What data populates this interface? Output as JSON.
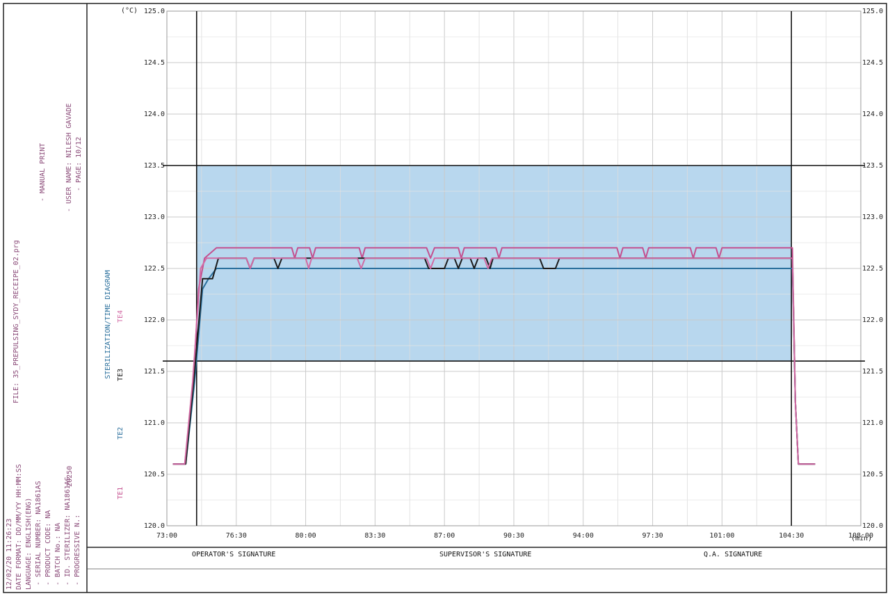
{
  "header": {
    "file": "FILE: 35_PREPULSING_SYDY_RECEIPE_02.prg",
    "manual_print": "- MANUAL PRINT",
    "user_name": "- USER NAME: NILESH GAVADE",
    "page": "- PAGE: 10/12",
    "datetime": "12/02/20 11:26:23",
    "date_format": "DATE FORMAT: DD/MM/YY HH:MM:SS",
    "language": "LANGUAGE: ENGLISH(ENG)",
    "serial_number": "- SERIAL NUMBER: NA1861AS",
    "product_code": "- PRODUCT CODE: NA",
    "batch_no": "- BATCH No.: NA",
    "id_sterilizer": "- ID. STERILIZER: NA1861AS",
    "progressive_n": "- PROGRESSIVE N.:",
    "progressive_val": "20250"
  },
  "colors": {
    "band": "#b8d7ee",
    "te1": "#c4508f",
    "te2": "#2a6f9c",
    "te3": "#1a1a1a",
    "te4": "#d26aa4",
    "grid": "#c9c9c9"
  },
  "signatures": {
    "operator": "OPERATOR'S SIGNATURE",
    "supervisor": "SUPERVISOR'S SIGNATURE",
    "qa": "Q.A. SIGNATURE"
  },
  "chart_data": {
    "type": "line",
    "title": "STERILIZATION/TIME DIAGRAM",
    "ylabel": "(°C)",
    "xlabel": "(min)",
    "xlim": [
      73,
      108
    ],
    "ylim": [
      120.0,
      125.0
    ],
    "x_ticks": [
      73,
      76.5,
      80,
      83.5,
      87,
      90.5,
      94,
      97.5,
      101,
      104.5,
      108
    ],
    "x_tick_labels": [
      "73:00",
      "76:30",
      "80:00",
      "83:30",
      "87:00",
      "90:30",
      "94:00",
      "97:30",
      "101:00",
      "104:30",
      "108:00"
    ],
    "y_ticks": [
      120.0,
      120.5,
      121.0,
      121.5,
      122.0,
      122.5,
      123.0,
      123.5,
      124.0,
      124.5,
      125.0
    ],
    "y_tick_labels": [
      "120.0",
      "120.5",
      "121.0",
      "121.5",
      "122.0",
      "122.5",
      "123.0",
      "123.5",
      "124.0",
      "124.5",
      "125.0"
    ],
    "band": [
      121.6,
      123.5
    ],
    "band_x": [
      74.5,
      104.5
    ],
    "vlines": [
      74.5,
      104.5
    ],
    "grid": true,
    "series": [
      {
        "name": "TE1",
        "color": "#c4508f",
        "points": [
          [
            73.3,
            120.6
          ],
          [
            73.9,
            120.6
          ],
          [
            74.3,
            121.3
          ],
          [
            74.6,
            122.3
          ],
          [
            74.9,
            122.6
          ],
          [
            75.5,
            122.7
          ],
          [
            79.3,
            122.7
          ],
          [
            79.45,
            122.6
          ],
          [
            79.6,
            122.7
          ],
          [
            80.2,
            122.7
          ],
          [
            80.35,
            122.6
          ],
          [
            80.5,
            122.7
          ],
          [
            82.7,
            122.7
          ],
          [
            82.85,
            122.6
          ],
          [
            83.0,
            122.7
          ],
          [
            86.1,
            122.7
          ],
          [
            86.3,
            122.6
          ],
          [
            86.5,
            122.7
          ],
          [
            87.7,
            122.7
          ],
          [
            87.85,
            122.6
          ],
          [
            88.0,
            122.7
          ],
          [
            89.6,
            122.7
          ],
          [
            89.75,
            122.6
          ],
          [
            89.9,
            122.7
          ],
          [
            95.7,
            122.7
          ],
          [
            95.85,
            122.6
          ],
          [
            96.0,
            122.7
          ],
          [
            97.0,
            122.7
          ],
          [
            97.15,
            122.6
          ],
          [
            97.3,
            122.7
          ],
          [
            99.4,
            122.7
          ],
          [
            99.55,
            122.6
          ],
          [
            99.7,
            122.7
          ],
          [
            100.7,
            122.7
          ],
          [
            100.85,
            122.6
          ],
          [
            101.0,
            122.7
          ],
          [
            104.55,
            122.7
          ],
          [
            104.7,
            121.2
          ],
          [
            104.85,
            120.6
          ],
          [
            105.7,
            120.6
          ]
        ]
      },
      {
        "name": "TE2",
        "color": "#2a6f9c",
        "points": [
          [
            73.3,
            120.6
          ],
          [
            73.95,
            120.6
          ],
          [
            74.4,
            121.4
          ],
          [
            74.8,
            122.3
          ],
          [
            75.1,
            122.4
          ],
          [
            75.5,
            122.5
          ],
          [
            104.55,
            122.5
          ],
          [
            104.7,
            121.2
          ],
          [
            104.85,
            120.6
          ],
          [
            105.7,
            120.6
          ]
        ]
      },
      {
        "name": "TE3",
        "color": "#1a1a1a",
        "points": [
          [
            73.3,
            120.6
          ],
          [
            73.95,
            120.6
          ],
          [
            74.4,
            121.5
          ],
          [
            74.8,
            122.4
          ],
          [
            75.3,
            122.4
          ],
          [
            75.6,
            122.6
          ],
          [
            77.0,
            122.6
          ],
          [
            77.2,
            122.5
          ],
          [
            77.4,
            122.6
          ],
          [
            78.4,
            122.6
          ],
          [
            78.6,
            122.5
          ],
          [
            78.8,
            122.6
          ],
          [
            86.0,
            122.6
          ],
          [
            86.2,
            122.5
          ],
          [
            87.0,
            122.5
          ],
          [
            87.2,
            122.6
          ],
          [
            87.5,
            122.6
          ],
          [
            87.7,
            122.5
          ],
          [
            87.9,
            122.6
          ],
          [
            88.3,
            122.6
          ],
          [
            88.5,
            122.5
          ],
          [
            88.7,
            122.6
          ],
          [
            89.1,
            122.6
          ],
          [
            89.3,
            122.5
          ],
          [
            89.45,
            122.6
          ],
          [
            91.8,
            122.6
          ],
          [
            92.0,
            122.5
          ],
          [
            92.6,
            122.5
          ],
          [
            92.8,
            122.6
          ],
          [
            104.55,
            122.6
          ],
          [
            104.7,
            121.2
          ],
          [
            104.85,
            120.6
          ],
          [
            105.7,
            120.6
          ]
        ]
      },
      {
        "name": "TE4",
        "color": "#d26aa4",
        "points": [
          [
            73.3,
            120.6
          ],
          [
            73.9,
            120.6
          ],
          [
            74.3,
            121.4
          ],
          [
            74.7,
            122.5
          ],
          [
            75.0,
            122.6
          ],
          [
            77.0,
            122.6
          ],
          [
            77.2,
            122.5
          ],
          [
            77.4,
            122.6
          ],
          [
            80.0,
            122.6
          ],
          [
            80.15,
            122.5
          ],
          [
            80.3,
            122.6
          ],
          [
            82.6,
            122.6
          ],
          [
            82.8,
            122.5
          ],
          [
            83.0,
            122.6
          ],
          [
            86.1,
            122.6
          ],
          [
            86.3,
            122.5
          ],
          [
            86.5,
            122.6
          ],
          [
            89.0,
            122.6
          ],
          [
            89.2,
            122.5
          ],
          [
            89.4,
            122.6
          ],
          [
            104.55,
            122.6
          ],
          [
            104.7,
            121.2
          ],
          [
            104.85,
            120.6
          ],
          [
            105.7,
            120.6
          ]
        ]
      }
    ]
  }
}
